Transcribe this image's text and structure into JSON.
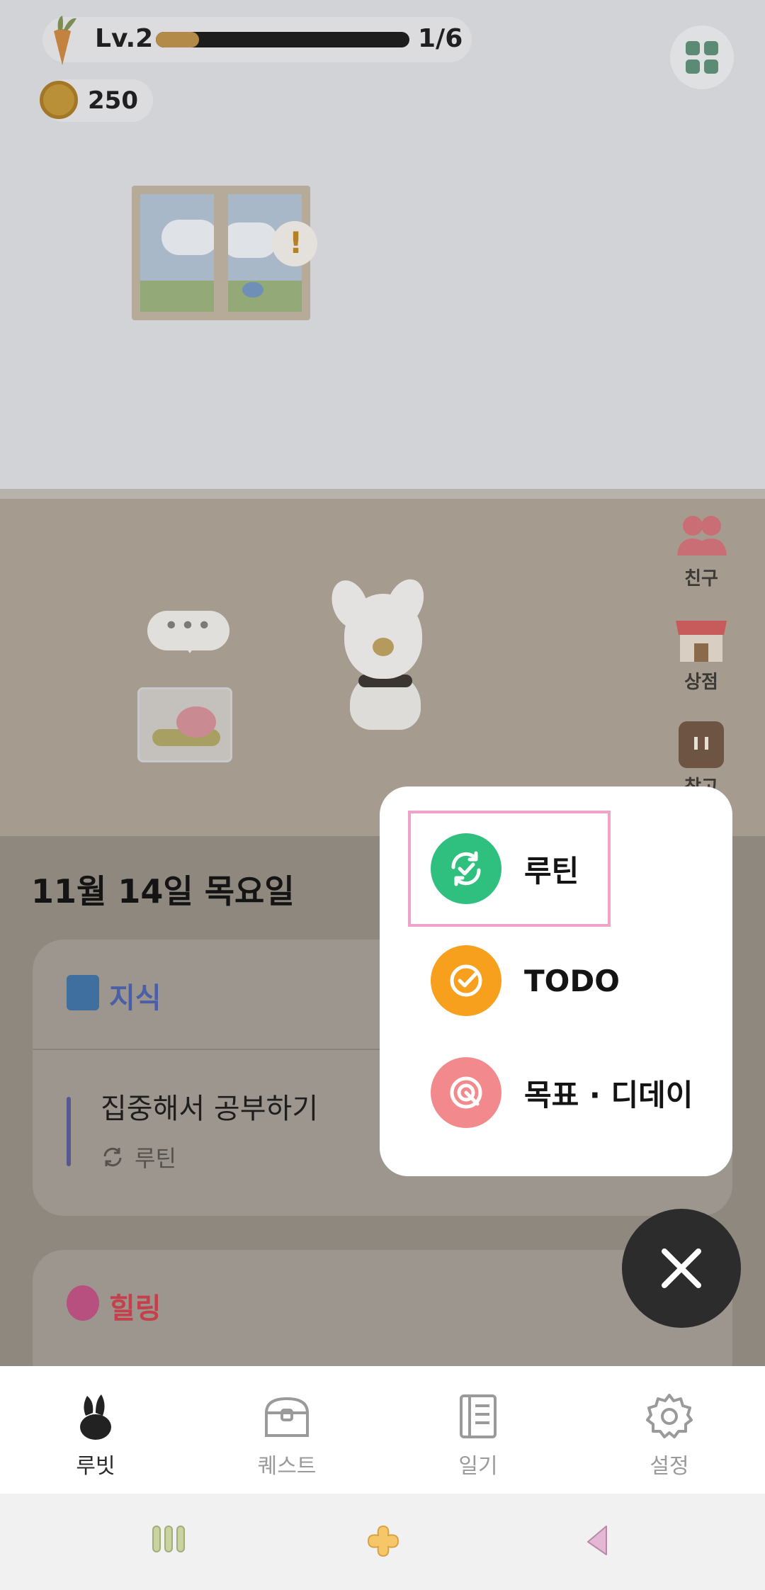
{
  "hud": {
    "level_label": "Lv.2",
    "xp_text": "1/6",
    "xp_progress": 0.17,
    "coins": "250"
  },
  "room": {
    "alert_mark": "!",
    "speech_text": "•••",
    "side_buttons": {
      "friends": "친구",
      "shop": "상점",
      "storage": "창고"
    }
  },
  "content": {
    "date": "11월 14일 목요일",
    "categories": [
      {
        "name": "지식",
        "icon": "blue-book-icon",
        "color": "#4b5fa8",
        "tasks": [
          {
            "title": "집중해서 공부하기",
            "type": "루틴"
          }
        ]
      },
      {
        "name": "힐링",
        "icon": "sparkling-heart-icon",
        "color": "#c4404b",
        "tasks": []
      }
    ]
  },
  "add_menu": {
    "items": [
      {
        "label": "루틴",
        "icon": "routine-refresh-check-icon",
        "color": "#2fbf7e"
      },
      {
        "label": "TODO",
        "icon": "todo-check-icon",
        "color": "#f7a01e"
      },
      {
        "label": "목표 · 디데이",
        "icon": "target-arrow-icon",
        "color": "#f28a8d"
      }
    ],
    "highlight_color": "#f0a3c8"
  },
  "tabbar": {
    "tabs": [
      {
        "label": "루빗",
        "icon": "rabbit-icon",
        "active": true
      },
      {
        "label": "퀘스트",
        "icon": "treasure-chest-icon",
        "active": false
      },
      {
        "label": "일기",
        "icon": "diary-icon",
        "active": false
      },
      {
        "label": "설정",
        "icon": "gear-icon",
        "active": false
      }
    ]
  }
}
